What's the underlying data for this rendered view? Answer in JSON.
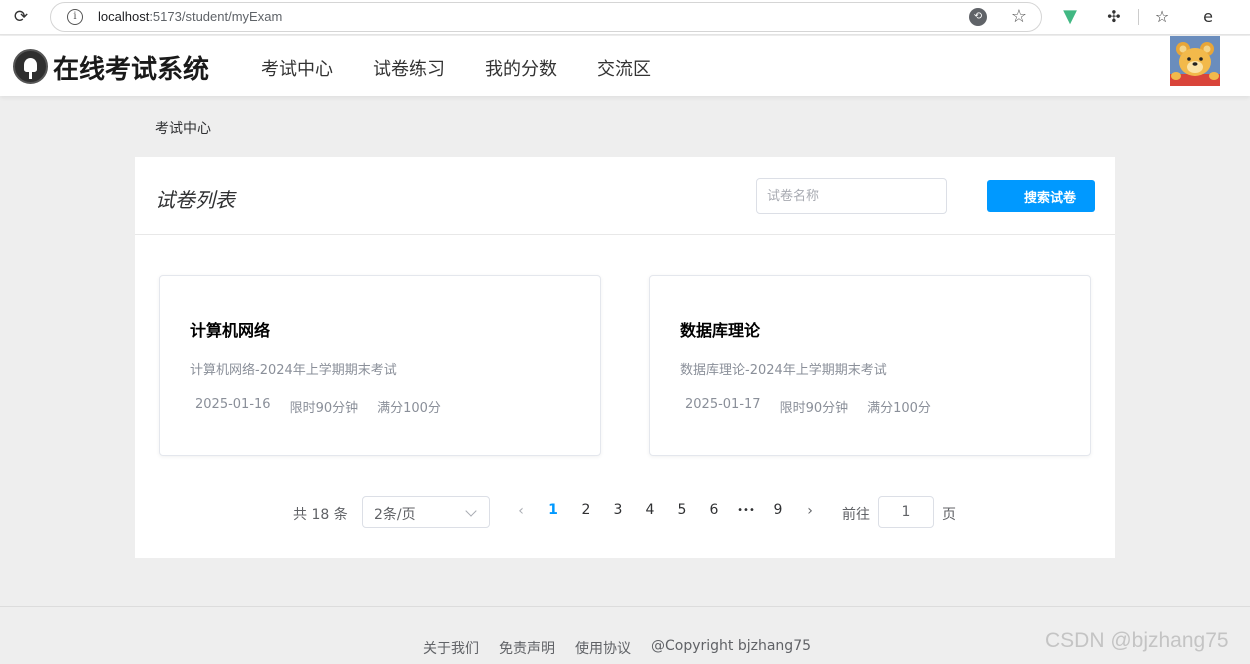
{
  "browser": {
    "url_host": "localhost",
    "url_path": ":5173/student/myExam",
    "icons": [
      "reload-icon",
      "info-icon",
      "translate-icon",
      "star-icon",
      "vue-devtools-icon",
      "extensions-icon",
      "favorites-icon",
      "edge-icon"
    ]
  },
  "header": {
    "logo_text": "在线考试系统",
    "nav": [
      "考试中心",
      "试卷练习",
      "我的分数",
      "交流区"
    ]
  },
  "breadcrumb": "考试中心",
  "panel": {
    "title": "试卷列表",
    "search_placeholder": "试卷名称",
    "search_button": "搜索试卷"
  },
  "exams": [
    {
      "title": "计算机网络",
      "desc": "计算机网络-2024年上学期期末考试",
      "date": "2025-01-16",
      "limit": "限时90分钟",
      "score": "满分100分"
    },
    {
      "title": "数据库理论",
      "desc": "数据库理论-2024年上学期期末考试",
      "date": "2025-01-17",
      "limit": "限时90分钟",
      "score": "满分100分"
    }
  ],
  "pagination": {
    "total_text": "共 18 条",
    "page_size": "2条/页",
    "prev": "‹",
    "next": "›",
    "pages": [
      "1",
      "2",
      "3",
      "4",
      "5",
      "6",
      "•••",
      "9"
    ],
    "current": "1",
    "goto_label": "前往",
    "goto_value": "1",
    "page_suffix": "页"
  },
  "footer": {
    "links": [
      "关于我们",
      "免责声明",
      "使用协议",
      "@Copyright bjzhang75"
    ]
  },
  "watermark": "CSDN @bjzhang75",
  "colors": {
    "accent": "#0099ff",
    "background": "#eeeeee"
  }
}
